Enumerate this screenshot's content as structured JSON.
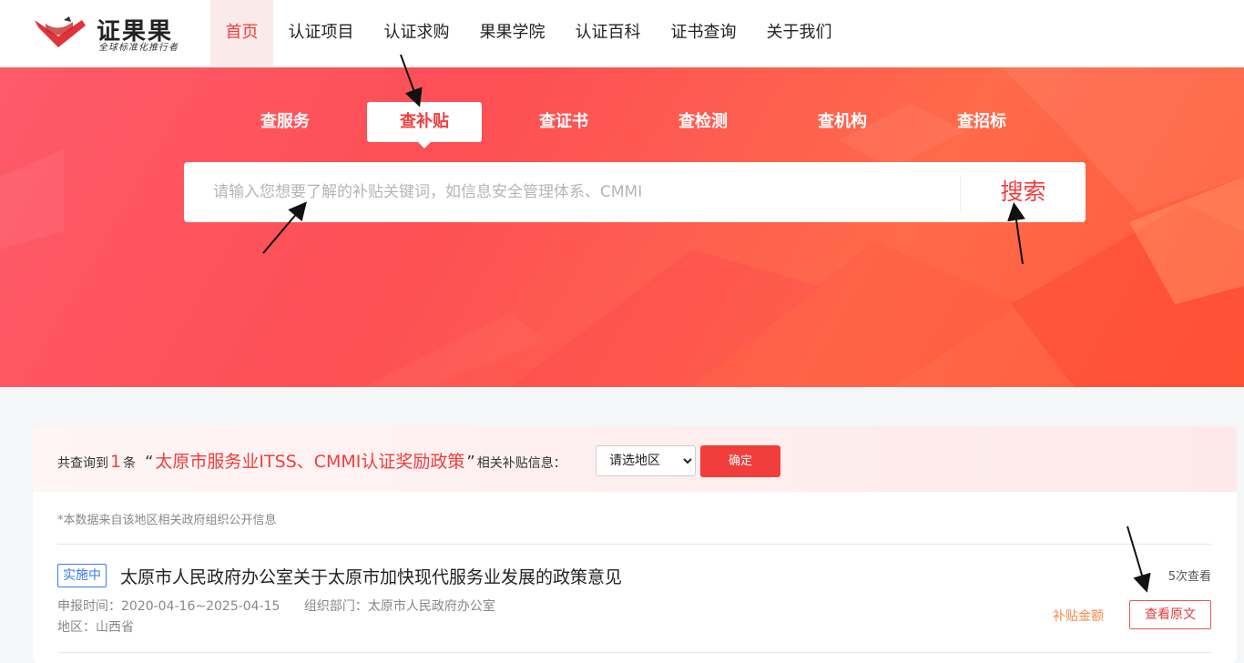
{
  "brand": {
    "name": "证果果",
    "slogan": "全球标准化推行者",
    "color": "#f23d3d"
  },
  "nav": {
    "items": [
      "首页",
      "认证项目",
      "认证求购",
      "果果学院",
      "认证百科",
      "证书查询",
      "关于我们"
    ],
    "active_index": 0
  },
  "search": {
    "tabs": [
      "查服务",
      "查补贴",
      "查证书",
      "查检测",
      "查机构",
      "查招标"
    ],
    "active_tab_index": 1,
    "placeholder": "请输入您想要了解的补贴关键词，如信息安全管理体系、CMMI",
    "value": "",
    "button_label": "搜索"
  },
  "results": {
    "prefix": "共查询到",
    "count": "1",
    "unit": "条",
    "open_quote": "“",
    "keyword": "太原市服务业ITSS、CMMI认证奖励政策",
    "close_quote": "”",
    "suffix": "相关补贴信息：",
    "region_select": {
      "selected": "请选地区",
      "options": [
        "请选地区"
      ]
    },
    "confirm_label": "确定",
    "note": "*本数据来自该地区相关政府组织公开信息",
    "items": [
      {
        "status": "实施中",
        "title": "太原市人民政府办公室关于太原市加快现代服务业发展的政策意见",
        "declare_time_label": "申报时间：",
        "declare_time": "2020-04-16~2025-04-15",
        "org_label": "组织部门：",
        "org": "太原市人民政府办公室",
        "region_label": "地区：",
        "region": "山西省",
        "views": "5次查看",
        "subsidy_label": "补贴金额",
        "view_original_label": "查看原文"
      }
    ]
  },
  "colors": {
    "accent": "#f23d3d",
    "status_blue": "#3b7be8",
    "subsidy_orange": "#f58a4a"
  }
}
